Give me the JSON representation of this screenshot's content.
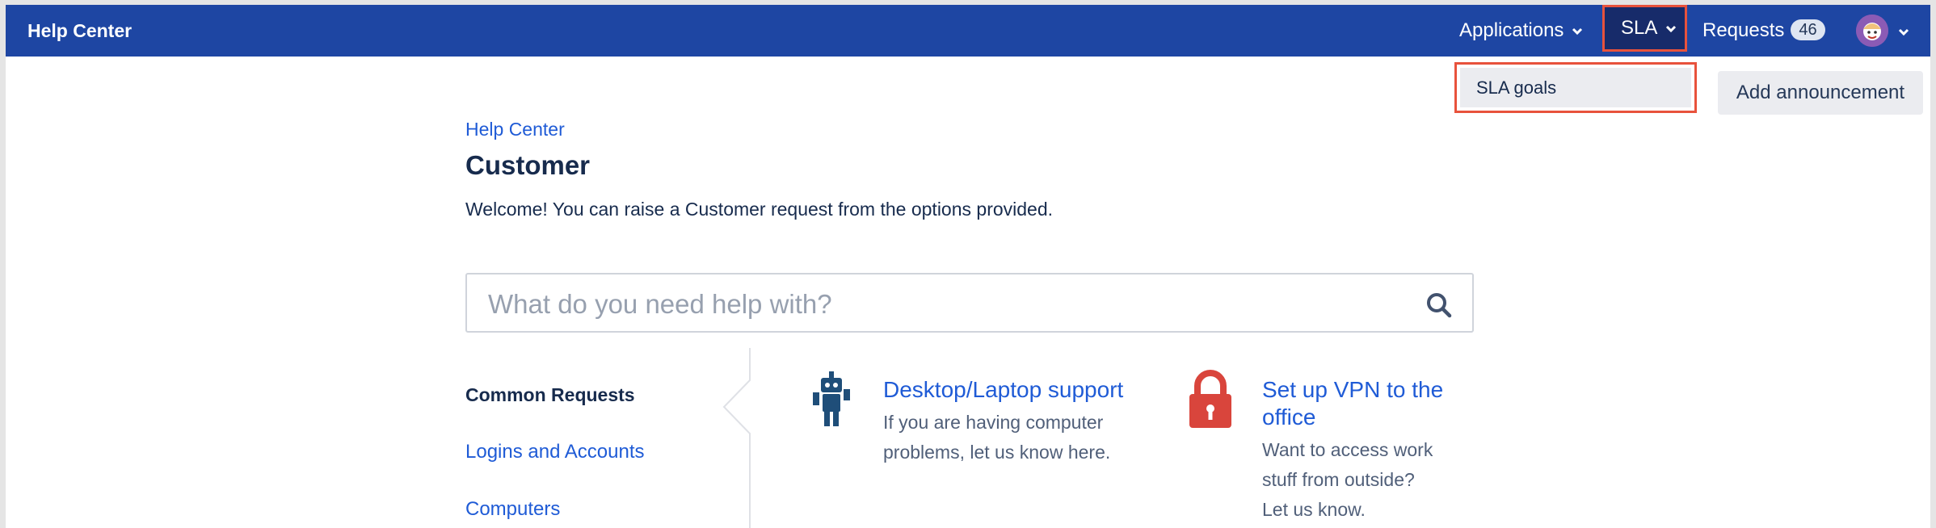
{
  "topbar": {
    "brand": "Help Center",
    "applications": "Applications",
    "sla": "SLA",
    "requests": "Requests",
    "requests_count": "46"
  },
  "dropdown": {
    "item": "SLA goals"
  },
  "add_announcement": "Add announcement",
  "main": {
    "breadcrumb": "Help Center",
    "title": "Customer",
    "welcome": "Welcome! You can raise a Customer request from the options provided.",
    "search_placeholder": "What do you need help with?"
  },
  "sidebar": {
    "title": "Common Requests",
    "links": [
      "Logins and Accounts",
      "Computers"
    ]
  },
  "cards": [
    {
      "icon": "robot-icon",
      "title_lines": [
        "Desktop/Laptop support"
      ],
      "desc_lines": [
        "If you are having computer",
        "problems, let us know here."
      ]
    },
    {
      "icon": "lock-icon",
      "title_lines": [
        "Set up VPN to the",
        "office"
      ],
      "desc_lines": [
        "Want to access work",
        "stuff from outside?",
        "Let us know."
      ]
    }
  ],
  "colors": {
    "topbar": "#1e46a3",
    "link": "#1f5bd6",
    "highlight": "#e8523c",
    "lock": "#d9453c",
    "robot": "#1f4e79"
  }
}
